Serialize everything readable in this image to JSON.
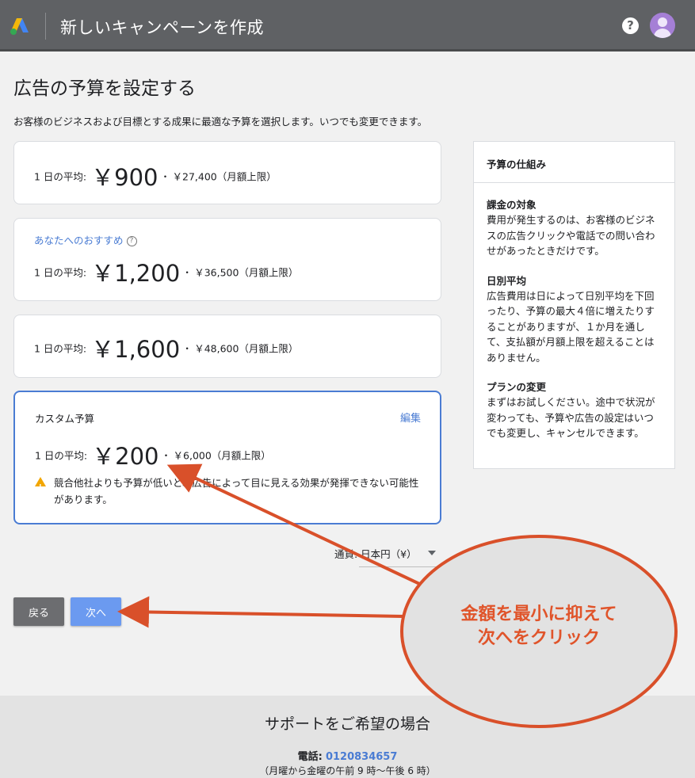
{
  "header": {
    "title": "新しいキャンペーンを作成",
    "help_icon": "?",
    "icons": [
      "google-ads-logo",
      "help-icon",
      "avatar"
    ]
  },
  "page": {
    "title": "広告の予算を設定する",
    "description": "お客様のビジネスおよび目標とする成果に最適な予算を選択します。いつでも変更できます。"
  },
  "budgets": [
    {
      "daily_label": "1 日の平均:",
      "amount": "￥900",
      "separator": "・",
      "monthly": "￥27,400（月額上限）"
    },
    {
      "recommend_label": "あなたへのおすすめ",
      "daily_label": "1 日の平均:",
      "amount": "￥1,200",
      "separator": "・",
      "monthly": "￥36,500（月額上限）"
    },
    {
      "daily_label": "1 日の平均:",
      "amount": "￥1,600",
      "separator": "・",
      "monthly": "￥48,600（月額上限）"
    }
  ],
  "custom": {
    "title": "カスタム予算",
    "edit_label": "編集",
    "daily_label": "1 日の平均:",
    "amount": "￥200",
    "separator": "・",
    "monthly": "￥6,000（月額上限）",
    "warning": "競合他社よりも予算が低いと、広告によって目に見える効果が発揮できない可能性があります。"
  },
  "sidebar": {
    "title": "予算の仕組み",
    "sections": [
      {
        "heading": "課金の対象",
        "body": "費用が発生するのは、お客様のビジネスの広告クリックや電話での問い合わせがあったときだけです。"
      },
      {
        "heading": "日別平均",
        "body": "広告費用は日によって日別平均を下回ったり、予算の最大４倍に増えたりすることがありますが、１か月を通して、支払額が月額上限を超えることはありません。"
      },
      {
        "heading": "プランの変更",
        "body": "まずはお試しください。途中で状況が変わっても、予算や広告の設定はいつでも変更し、キャンセルできます。"
      }
    ]
  },
  "currency": {
    "label": "通貨: 日本円（¥）"
  },
  "buttons": {
    "back": "戻る",
    "next": "次へ"
  },
  "footer": {
    "title": "サポートをご希望の場合",
    "phone_label": "電話:",
    "phone_number": "0120834657",
    "hours": "（月曜から金曜の午前 9 時〜午後 6 時）"
  },
  "annotation": {
    "line1": "金額を最小に抑えて",
    "line2": "次へをクリック",
    "color": "#e0542a"
  },
  "colors": {
    "accent": "#4a7cd3",
    "header_bg": "#5f6164",
    "next_button": "#6b9af0",
    "warning": "#f2a600"
  }
}
